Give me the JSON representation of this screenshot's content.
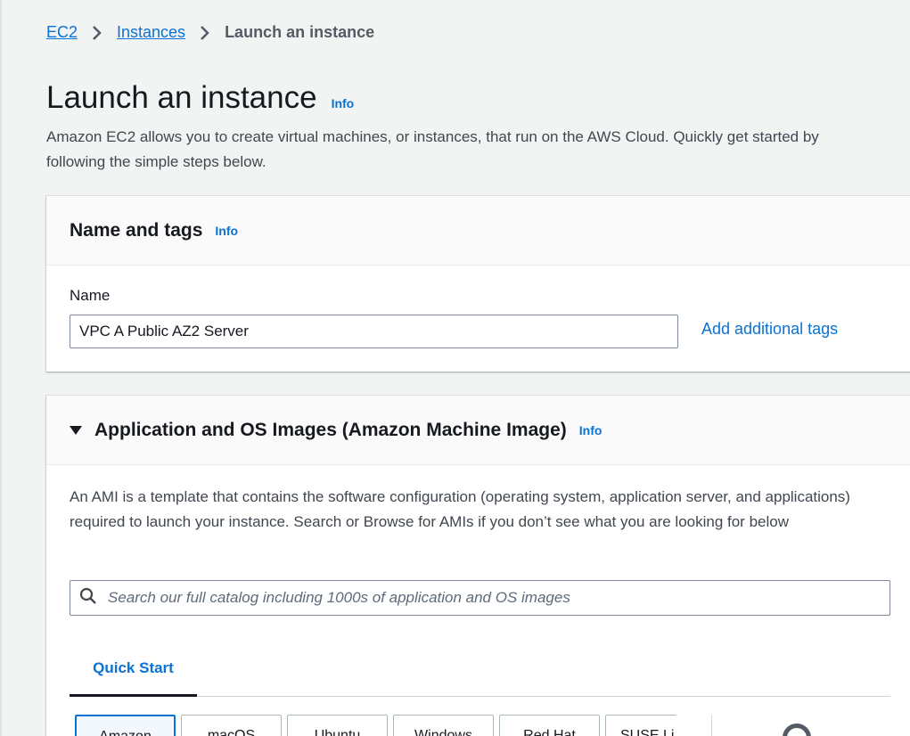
{
  "breadcrumb": {
    "items": [
      "EC2",
      "Instances"
    ],
    "current": "Launch an instance"
  },
  "page": {
    "title": "Launch an instance",
    "info": "Info",
    "description": "Amazon EC2 allows you to create virtual machines, or instances, that run on the AWS Cloud. Quickly get started by following the simple steps below."
  },
  "name_tags": {
    "title": "Name and tags",
    "info": "Info",
    "name_label": "Name",
    "name_value": "VPC A Public AZ2 Server",
    "add_tags": "Add additional tags"
  },
  "ami": {
    "title": "Application and OS Images (Amazon Machine Image)",
    "info": "Info",
    "description": "An AMI is a template that contains the software configuration (operating system, application server, and applications) required to launch your instance. Search or Browse for AMIs if you don’t see what you are looking for below",
    "search_placeholder": "Search our full catalog including 1000s of application and OS images",
    "tab_quickstart": "Quick Start",
    "os_tiles": [
      "Amazon",
      "macOS",
      "Ubuntu",
      "Windows",
      "Red Hat",
      "SUSE Li"
    ]
  },
  "colors": {
    "link": "#0972d3",
    "background": "#f2f3f3",
    "text": "#16191f"
  }
}
